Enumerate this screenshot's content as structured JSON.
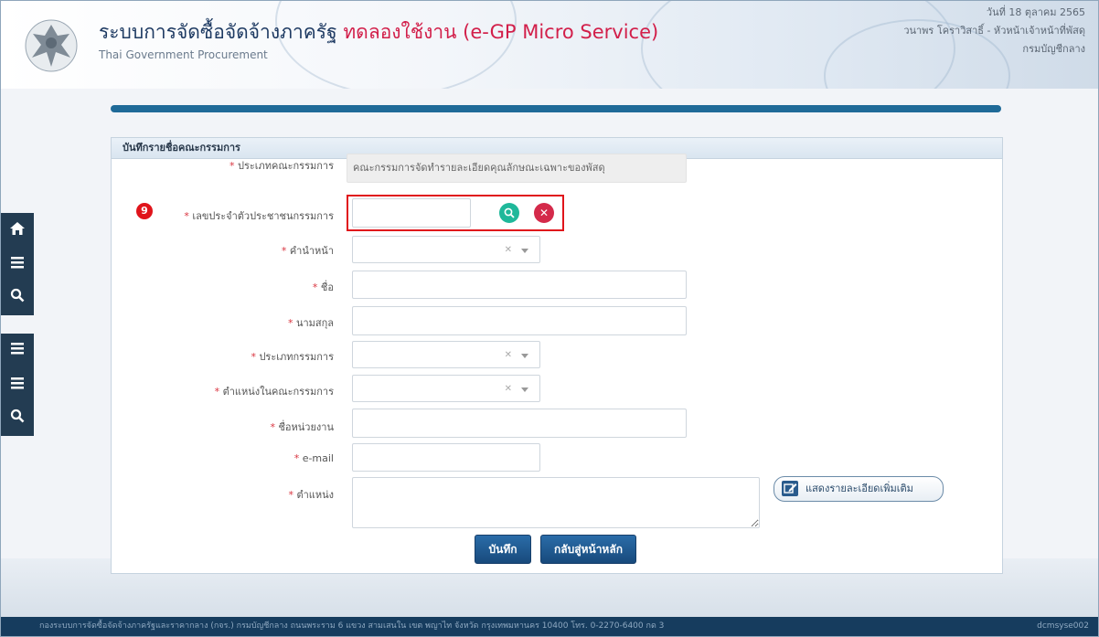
{
  "header": {
    "title": "ระบบการจัดซื้อจัดจ้างภาครัฐ",
    "title_test": "ทดลองใช้งาน (e-GP Micro Service)",
    "subtitle": "Thai Government Procurement",
    "date": "วันที่ 18 ตุลาคม 2565",
    "user": "วนาพร โคราวิสาธิ์ - หัวหน้าเจ้าหน้าที่พัสดุ",
    "department": "กรมบัญชีกลาง"
  },
  "sidebar": {
    "home_icon": "home-icon",
    "menu_icon": "menu-icon",
    "search_icon": "search-icon"
  },
  "panel": {
    "title": "บันทึกรายชื่อคณะกรรมการ",
    "fields": {
      "committee_type": {
        "label": "ประเภทคณะกรรมการ",
        "value": "คณะกรรมการจัดทำรายละเอียดคุณลักษณะเฉพาะของพัสดุ"
      },
      "citizen_id": {
        "label": "เลขประจำตัวประชาชนกรรมการ",
        "value": ""
      },
      "prefix": {
        "label": "คำนำหน้า",
        "value": ""
      },
      "first_name": {
        "label": "ชื่อ",
        "value": ""
      },
      "last_name": {
        "label": "นามสกุล",
        "value": ""
      },
      "member_type": {
        "label": "ประเภทกรรมการ",
        "value": ""
      },
      "position_in_committee": {
        "label": "ตำแหน่งในคณะกรรมการ",
        "value": ""
      },
      "agency": {
        "label": "ชื่อหน่วยงาน",
        "value": ""
      },
      "email": {
        "label": "e-mail",
        "value": ""
      },
      "position": {
        "label": "ตำแหน่ง",
        "value": ""
      }
    },
    "required_mark": "*",
    "step_badge": "9",
    "more_details_label": "แสดงรายละเอียดเพิ่มเติม",
    "save_label": "บันทึก",
    "back_label": "กลับสู่หน้าหลัก"
  },
  "footer": {
    "address": "กองระบบการจัดซื้อจัดจ้างภาครัฐและราคากลาง (กจร.) กรมบัญชีกลาง ถนนพระราม 6 แขวง สามเสนใน เขต พญาไท จังหวัด กรุงเทพมหานคร 10400 โทร. 0-2270-6400 กด 3",
    "server": "dcmsyse002"
  },
  "colors": {
    "accent": "#1f6a98",
    "danger": "#e0141b",
    "search_button": "#1fb89a",
    "clear_button": "#d42a4a",
    "sidebar": "#233c52",
    "footer": "#163c5e"
  }
}
